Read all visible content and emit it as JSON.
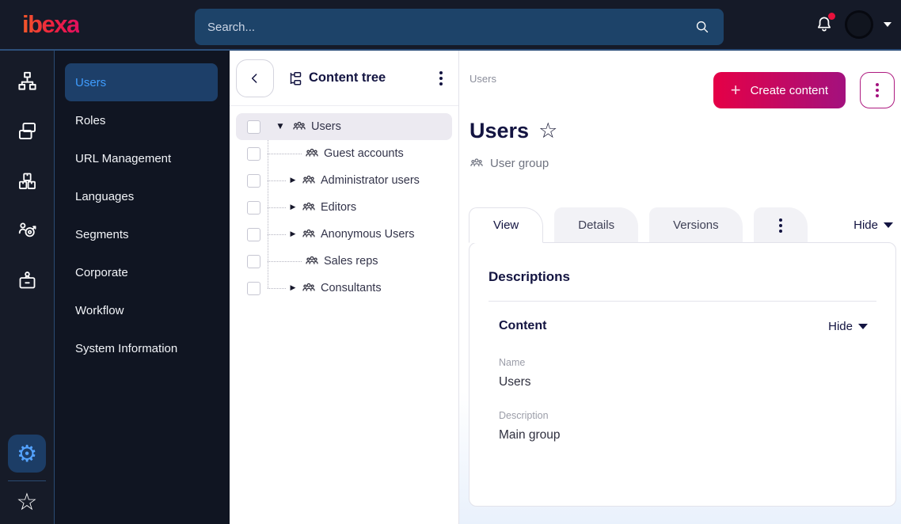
{
  "topbar": {
    "logo_text": "ibexa",
    "search_placeholder": "Search...",
    "has_unread_notifications": true
  },
  "icons": {
    "settings": "⚙",
    "bookmarks": "☆",
    "favorite": "☆",
    "plus": "+",
    "rail_items": [
      "content-structure-icon",
      "content-list-icon",
      "object-states-icon",
      "segmentation-icon",
      "corporate-badge-icon"
    ]
  },
  "sidebar": {
    "items": [
      {
        "label": "Users",
        "active": true
      },
      {
        "label": "Roles",
        "active": false
      },
      {
        "label": "URL Management",
        "active": false
      },
      {
        "label": "Languages",
        "active": false
      },
      {
        "label": "Segments",
        "active": false
      },
      {
        "label": "Corporate",
        "active": false
      },
      {
        "label": "Workflow",
        "active": false
      },
      {
        "label": "System Information",
        "active": false
      }
    ]
  },
  "tree": {
    "title": "Content tree",
    "items": [
      {
        "label": "Users",
        "expander": "▼",
        "selected": true,
        "level": 0
      },
      {
        "label": "Guest accounts",
        "expander": "",
        "selected": false,
        "level": 1
      },
      {
        "label": "Administrator users",
        "expander": "▶",
        "selected": false,
        "level": 1
      },
      {
        "label": "Editors",
        "expander": "▶",
        "selected": false,
        "level": 1
      },
      {
        "label": "Anonymous Users",
        "expander": "▶",
        "selected": false,
        "level": 1
      },
      {
        "label": "Sales reps",
        "expander": "",
        "selected": false,
        "level": 1
      },
      {
        "label": "Consultants",
        "expander": "▶",
        "selected": false,
        "level": 1
      }
    ]
  },
  "main": {
    "breadcrumb": "Users",
    "create_button_label": "Create content",
    "title": "Users",
    "content_type_label": "User group",
    "tabs": [
      {
        "label": "View",
        "active": true
      },
      {
        "label": "Details",
        "active": false
      },
      {
        "label": "Versions",
        "active": false
      }
    ],
    "hide_label": "Hide",
    "card": {
      "heading": "Descriptions",
      "section_title": "Content",
      "section_hide_label": "Hide",
      "fields": [
        {
          "label": "Name",
          "value": "Users"
        },
        {
          "label": "Description",
          "value": "Main group"
        }
      ]
    }
  },
  "colors": {
    "topbar_bg": "#151a28",
    "sidebar_bg": "#101522",
    "accent_blue": "#3f9dff",
    "brand_gradient_start": "#e50046",
    "brand_gradient_end": "#a3117e",
    "notification_dot": "#e8113c",
    "selected_row_bg": "#eceaf1"
  }
}
